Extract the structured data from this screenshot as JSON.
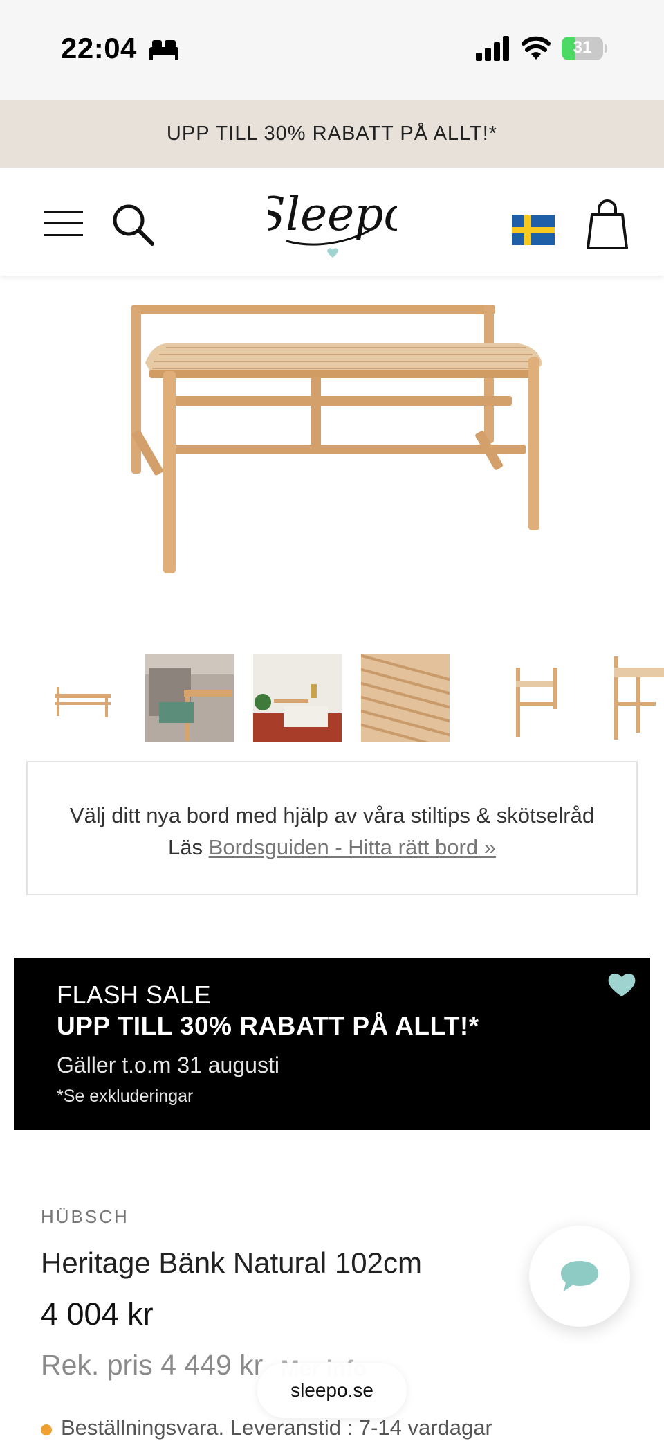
{
  "status_bar": {
    "time": "22:04",
    "battery_level": "31",
    "battery_fraction": 0.31,
    "icons": [
      "bed-icon",
      "signal-icon",
      "wifi-icon",
      "battery-icon"
    ]
  },
  "promo_banner": {
    "text": "UPP TILL 30% RABATT PÅ ALLT!*"
  },
  "header": {
    "logo_text": "Sleepo",
    "icons": [
      "menu-icon",
      "search-icon",
      "sweden-flag-icon",
      "shopping-bag-icon"
    ]
  },
  "gallery": {
    "thumbnail_count": 6
  },
  "guide": {
    "line1": "Välj ditt nya bord med hjälp av våra stiltips & skötselråd",
    "prefix": "Läs ",
    "link_text": "Bordsguiden - Hitta rätt bord »"
  },
  "flash_sale": {
    "title": "FLASH SALE",
    "headline": "UPP TILL 30% RABATT PÅ ALLT!*",
    "valid": "Gäller t.o.m 31 augusti",
    "exclusions": "*Se exkluderingar"
  },
  "product": {
    "brand": "HÜBSCH",
    "title": "Heritage Bänk Natural 102cm",
    "price": "4 004 kr",
    "rec_price": "Rek. pris 4 449 kr",
    "more_info": "Mer info",
    "stock_text": "Beställningsvara. Leveranstid : 7-14 vardagar"
  },
  "browser": {
    "url": "sleepo.se"
  },
  "colors": {
    "promo_bg": "#e7e1da",
    "accent_mint": "#9fd3cf",
    "flash_bg": "#000000",
    "stock_dot": "#f0a030"
  }
}
